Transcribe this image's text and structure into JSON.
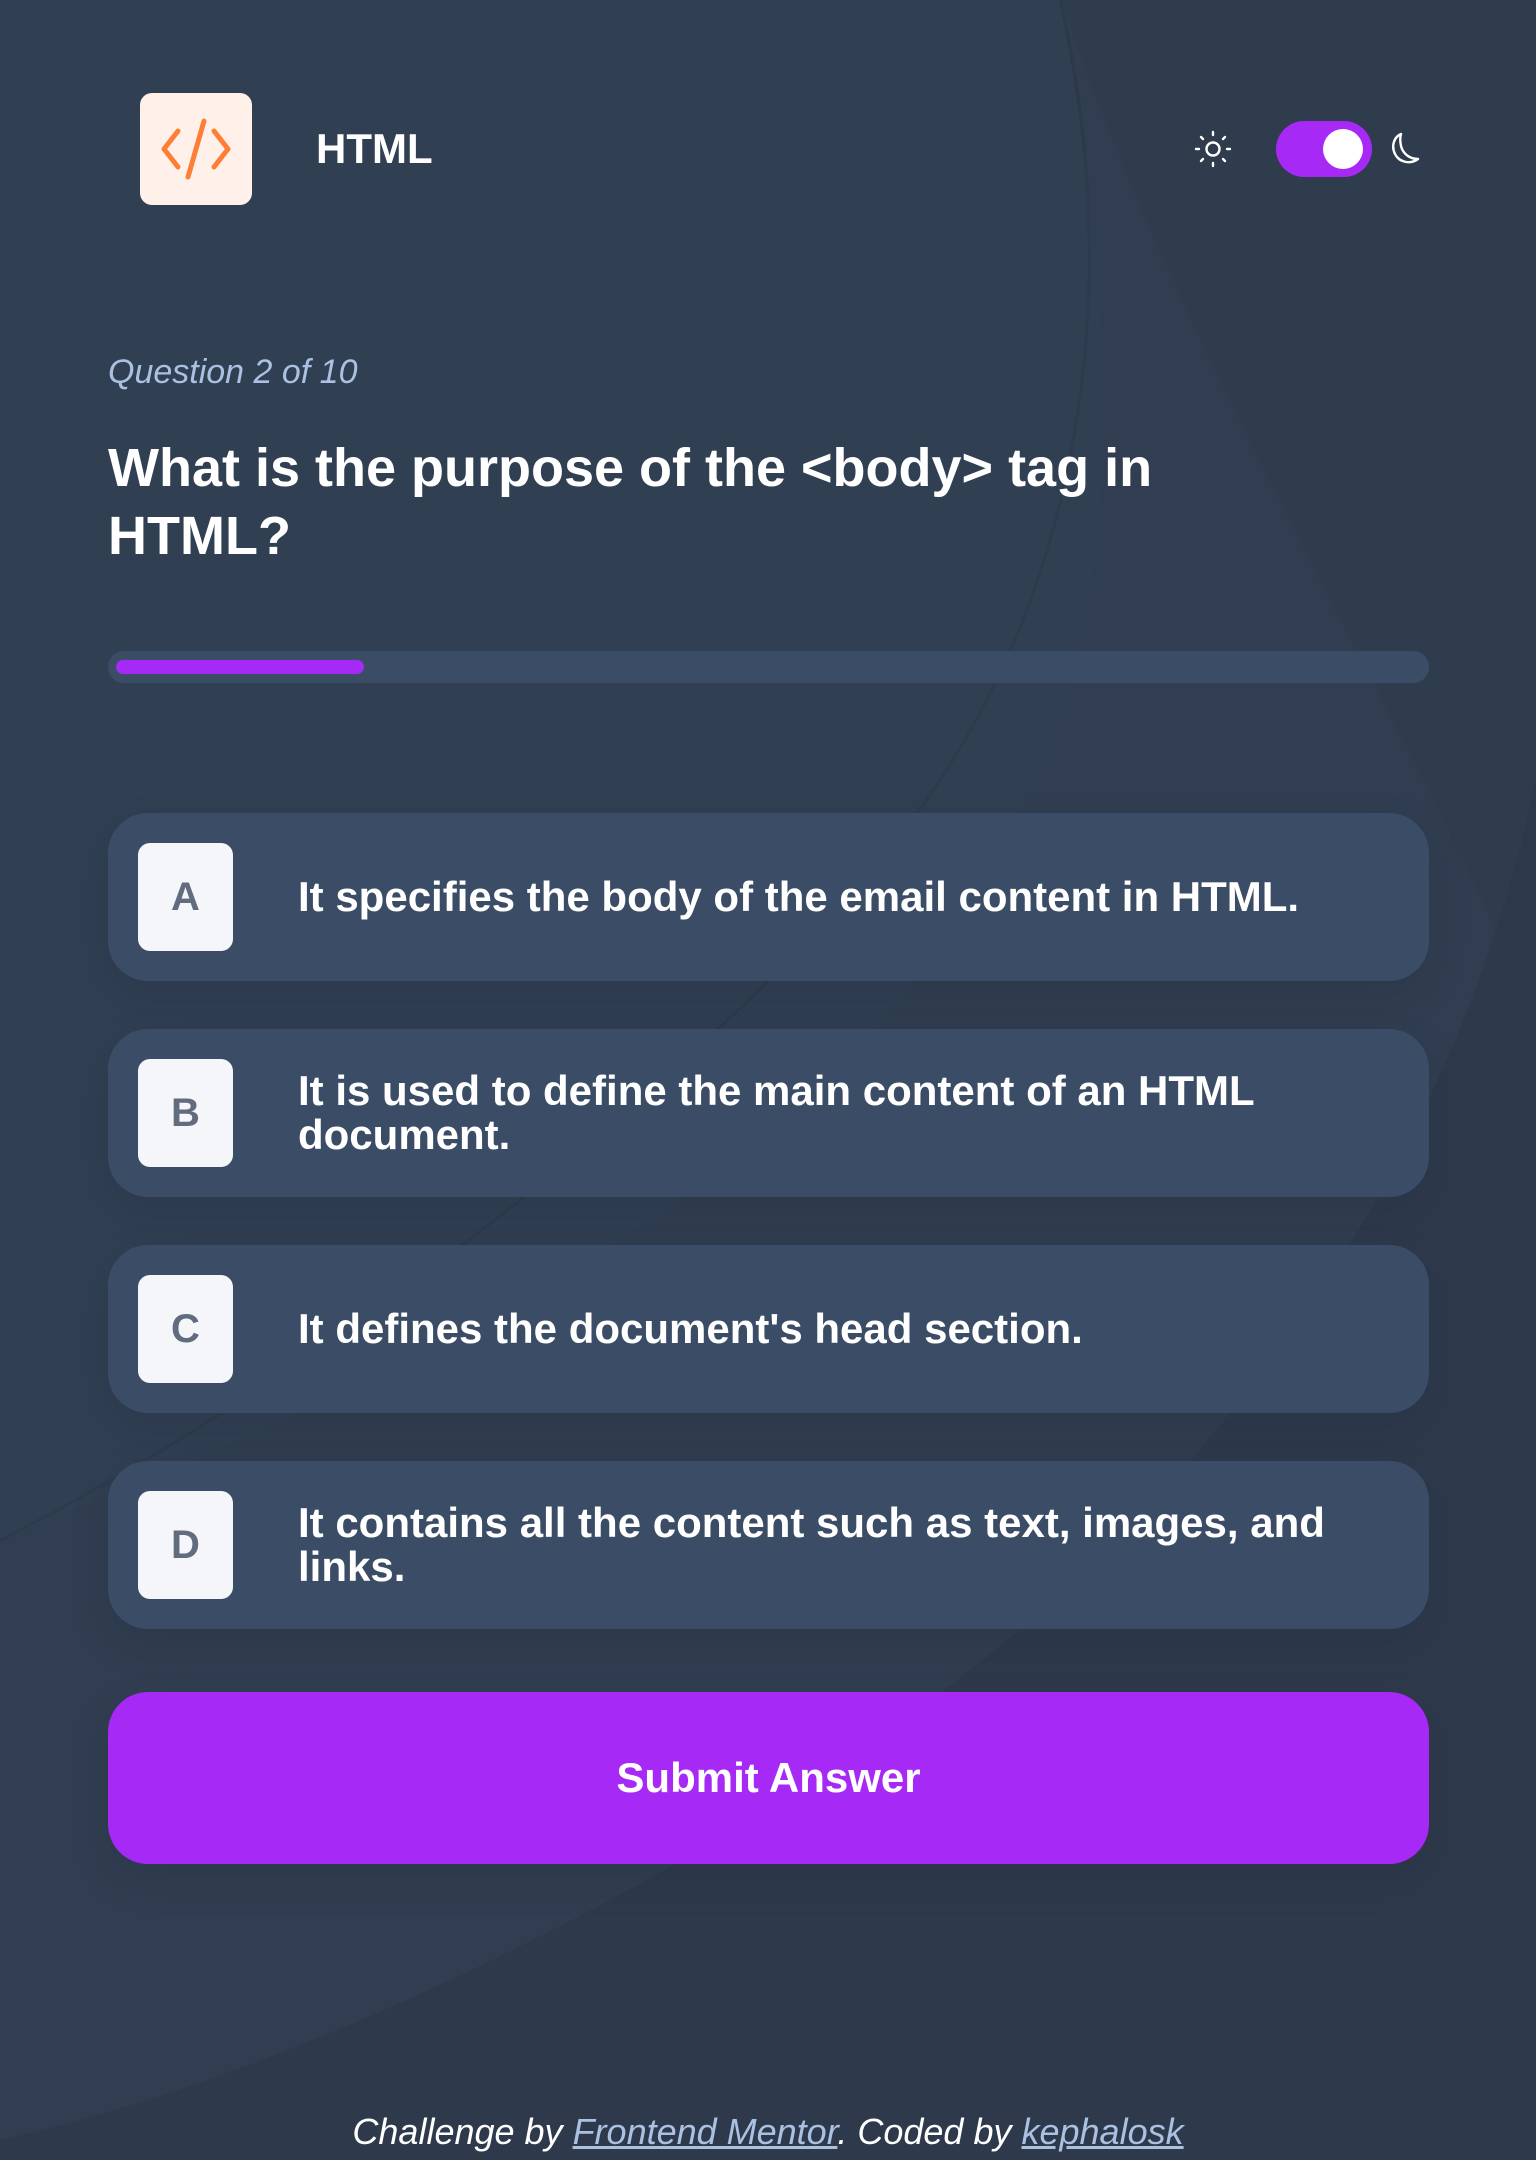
{
  "header": {
    "subject_title": "HTML",
    "subject_icon": "code-brackets-icon",
    "theme": {
      "sun_icon": "sun-icon",
      "moon_icon": "moon-icon",
      "dark_mode_on": true
    }
  },
  "question": {
    "counter": "Question 2 of 10",
    "text": "What is the purpose of the <body> tag in HTML?",
    "progress": 0.2
  },
  "answers": [
    {
      "letter": "A",
      "text": "It specifies the body of the email content in HTML."
    },
    {
      "letter": "B",
      "text": "It is used to define the main content of an HTML document."
    },
    {
      "letter": "C",
      "text": "It defines the document's head section."
    },
    {
      "letter": "D",
      "text": "It contains all the content such as text, images, and links."
    }
  ],
  "submit_label": "Submit Answer",
  "footer": {
    "prefix": "Challenge by ",
    "link1": "Frontend Mentor",
    "middle": ". Coded by ",
    "link2": "kephalosk"
  },
  "colors": {
    "background": "#313e51",
    "card": "#3b4d66",
    "accent": "#a729f5",
    "muted_text": "#abc1e1",
    "icon_orange": "#ff7e35",
    "icon_bg": "#fff1e9"
  }
}
